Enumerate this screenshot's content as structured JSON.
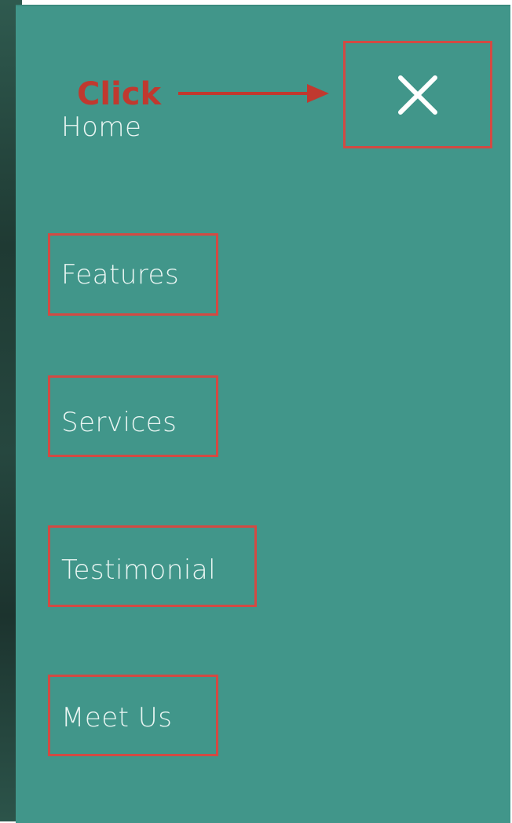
{
  "menu": {
    "items": [
      {
        "label": "Home"
      },
      {
        "label": "Features"
      },
      {
        "label": "Services"
      },
      {
        "label": "Testimonial"
      },
      {
        "label": "Meet Us"
      }
    ],
    "close_icon": "close-x-icon"
  },
  "annotation": {
    "label": "Click",
    "arrow_icon": "arrow-right-icon"
  },
  "colors": {
    "panel_background": "#41968a",
    "menu_text": "#eaf6f3",
    "highlight_border": "#d24a43",
    "annotation_text": "#c0392f"
  }
}
